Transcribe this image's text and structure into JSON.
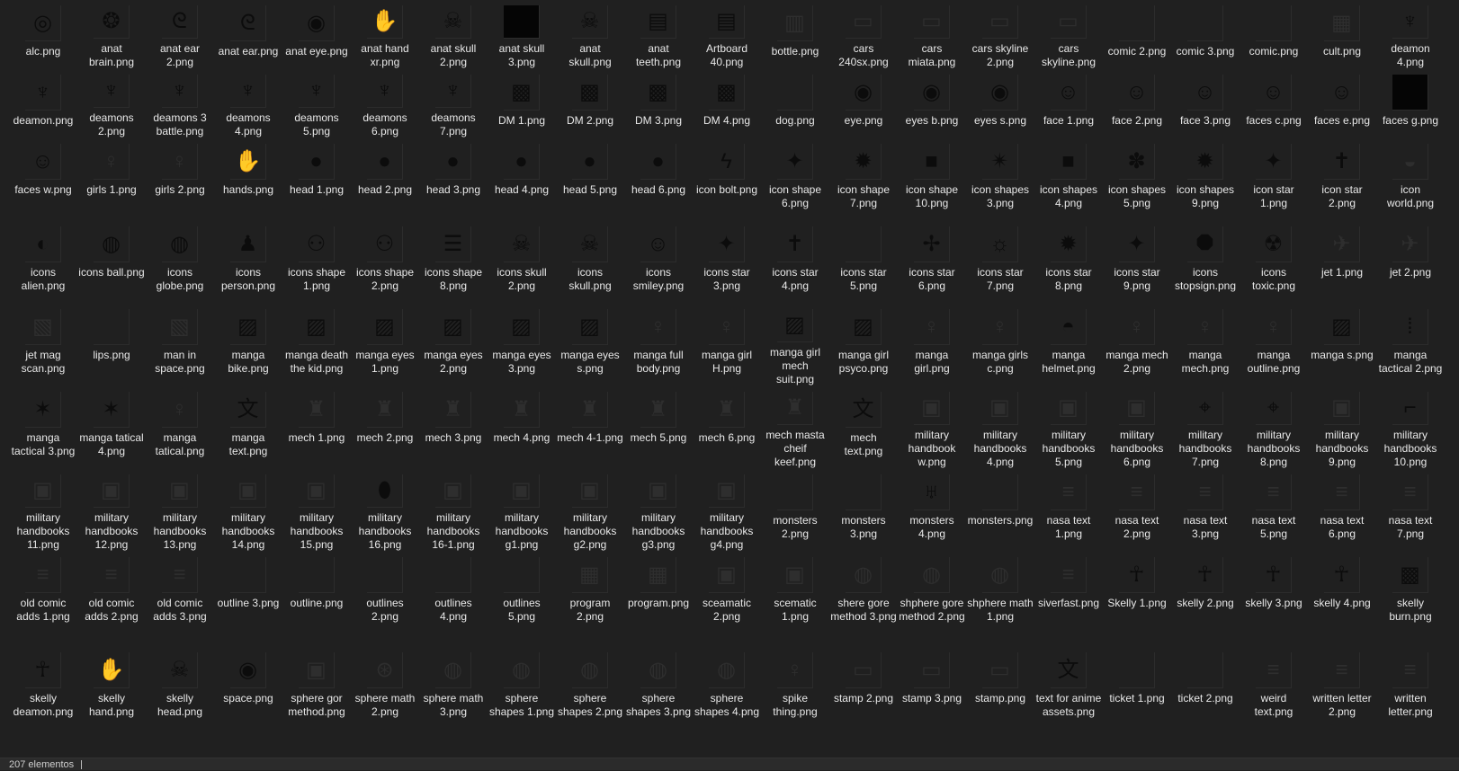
{
  "status": {
    "item_count": "207 elementos"
  },
  "files": [
    {
      "name": "alc.png",
      "icon": "vitruvian-icon"
    },
    {
      "name": "anat brain.png",
      "icon": "brain-icon"
    },
    {
      "name": "anat ear 2.png",
      "icon": "ear-icon"
    },
    {
      "name": "anat ear.png",
      "icon": "ear-icon"
    },
    {
      "name": "anat eye.png",
      "icon": "eye-icon"
    },
    {
      "name": "anat hand xr.png",
      "icon": "hand-icon"
    },
    {
      "name": "anat skull 2.png",
      "icon": "skull-icon"
    },
    {
      "name": "anat skull 3.png",
      "icon": "black-square-icon"
    },
    {
      "name": "anat skull.png",
      "icon": "skull-icon"
    },
    {
      "name": "anat teeth.png",
      "icon": "teeth-icon"
    },
    {
      "name": "Artboard 40.png",
      "icon": "teeth-icon"
    },
    {
      "name": "bottle.png",
      "icon": "bottle-icon"
    },
    {
      "name": "cars 240sx.png",
      "icon": "car-icon"
    },
    {
      "name": "cars miata.png",
      "icon": "car-icon"
    },
    {
      "name": "cars skyline 2.png",
      "icon": "car-icon"
    },
    {
      "name": "cars skyline.png",
      "icon": "car-icon"
    },
    {
      "name": "comic 2.png",
      "icon": "blank-icon"
    },
    {
      "name": "comic 3.png",
      "icon": "blank-icon"
    },
    {
      "name": "comic.png",
      "icon": "blank-icon"
    },
    {
      "name": "cult.png",
      "icon": "poster-icon"
    },
    {
      "name": "deamon 4.png",
      "icon": "demon-icon"
    },
    {
      "name": "deamon.png",
      "icon": "demon-icon"
    },
    {
      "name": "deamons 2.png",
      "icon": "demon-icon"
    },
    {
      "name": "deamons 3 battle.png",
      "icon": "demon-icon"
    },
    {
      "name": "deamons 4.png",
      "icon": "demon-icon"
    },
    {
      "name": "deamons 5.png",
      "icon": "demon-icon"
    },
    {
      "name": "deamons 6.png",
      "icon": "demon-icon"
    },
    {
      "name": "deamons 7.png",
      "icon": "demon-icon"
    },
    {
      "name": "DM 1.png",
      "icon": "dark-scene-icon"
    },
    {
      "name": "DM 2.png",
      "icon": "dark-scene-icon"
    },
    {
      "name": "DM 3.png",
      "icon": "dark-scene-icon"
    },
    {
      "name": "DM 4.png",
      "icon": "dark-scene-icon"
    },
    {
      "name": "dog.png",
      "icon": "blank-icon"
    },
    {
      "name": "eye.png",
      "icon": "eye-icon"
    },
    {
      "name": "eyes b.png",
      "icon": "eye-icon"
    },
    {
      "name": "eyes s.png",
      "icon": "eye-icon"
    },
    {
      "name": "face 1.png",
      "icon": "face-icon"
    },
    {
      "name": "face 2.png",
      "icon": "face-icon"
    },
    {
      "name": "face 3.png",
      "icon": "face-icon"
    },
    {
      "name": "faces c.png",
      "icon": "face-icon"
    },
    {
      "name": "faces e.png",
      "icon": "face-icon"
    },
    {
      "name": "faces g.png",
      "icon": "black-square-icon"
    },
    {
      "name": "faces w.png",
      "icon": "face-icon"
    },
    {
      "name": "girls 1.png",
      "icon": "figure-icon"
    },
    {
      "name": "girls 2.png",
      "icon": "figure-icon"
    },
    {
      "name": "hands.png",
      "icon": "hand-icon"
    },
    {
      "name": "head 1.png",
      "icon": "head-icon"
    },
    {
      "name": "head 2.png",
      "icon": "head-icon"
    },
    {
      "name": "head 3.png",
      "icon": "head-icon"
    },
    {
      "name": "head 4.png",
      "icon": "head-icon"
    },
    {
      "name": "head 5.png",
      "icon": "head-icon"
    },
    {
      "name": "head 6.png",
      "icon": "head-icon"
    },
    {
      "name": "icon bolt.png",
      "icon": "bolt-icon"
    },
    {
      "name": "icon shape 6.png",
      "icon": "sparkle-icon"
    },
    {
      "name": "icon shape 7.png",
      "icon": "starburst-icon"
    },
    {
      "name": "icon shape 10.png",
      "icon": "square-shape-icon"
    },
    {
      "name": "icon shapes 3.png",
      "icon": "octagram-icon"
    },
    {
      "name": "icon shapes 4.png",
      "icon": "square-shape-icon"
    },
    {
      "name": "icon shapes 5.png",
      "icon": "flower-icon"
    },
    {
      "name": "icon shapes 9.png",
      "icon": "starburst-icon"
    },
    {
      "name": "icon star 1.png",
      "icon": "star-icon"
    },
    {
      "name": "icon star 2.png",
      "icon": "cross-star-icon"
    },
    {
      "name": "icon world.png",
      "icon": "world-map-icon"
    },
    {
      "name": "icons alien.png",
      "icon": "alien-icon"
    },
    {
      "name": "icons ball.png",
      "icon": "globe-icon"
    },
    {
      "name": "icons globe.png",
      "icon": "globe-icon"
    },
    {
      "name": "icons person.png",
      "icon": "person-icon"
    },
    {
      "name": "icons shape 1.png",
      "icon": "node-shape-icon"
    },
    {
      "name": "icons shape 2.png",
      "icon": "node-shape-icon"
    },
    {
      "name": "icons shape 8.png",
      "icon": "stripes-icon"
    },
    {
      "name": "icons skull 2.png",
      "icon": "skull-crossbones-icon"
    },
    {
      "name": "icons skull.png",
      "icon": "skull-crossbones-icon"
    },
    {
      "name": "icons smiley.png",
      "icon": "smiley-icon"
    },
    {
      "name": "icons star 3.png",
      "icon": "star-icon"
    },
    {
      "name": "icons star 4.png",
      "icon": "cross-star-icon"
    },
    {
      "name": "icons star 5.png",
      "icon": "blank-icon"
    },
    {
      "name": "icons star 6.png",
      "icon": "pinwheel-icon"
    },
    {
      "name": "icons star 7.png",
      "icon": "sun-icon"
    },
    {
      "name": "icons star 8.png",
      "icon": "starburst-icon"
    },
    {
      "name": "icons star 9.png",
      "icon": "star-icon"
    },
    {
      "name": "icons stopsign.png",
      "icon": "stop-sign-icon"
    },
    {
      "name": "icons toxic.png",
      "icon": "radiation-icon"
    },
    {
      "name": "jet 1.png",
      "icon": "jet-icon"
    },
    {
      "name": "jet 2.png",
      "icon": "jet-icon"
    },
    {
      "name": "jet mag scan.png",
      "icon": "magazine-icon"
    },
    {
      "name": "lips.png",
      "icon": "blank-icon"
    },
    {
      "name": "man in space.png",
      "icon": "magazine-icon"
    },
    {
      "name": "manga bike.png",
      "icon": "manga-icon"
    },
    {
      "name": "manga death the kid.png",
      "icon": "manga-icon"
    },
    {
      "name": "manga eyes 1.png",
      "icon": "manga-icon"
    },
    {
      "name": "manga eyes 2.png",
      "icon": "manga-icon"
    },
    {
      "name": "manga eyes 3.png",
      "icon": "manga-icon"
    },
    {
      "name": "manga eyes s.png",
      "icon": "manga-icon"
    },
    {
      "name": "manga full body.png",
      "icon": "figure-icon"
    },
    {
      "name": "manga girl H.png",
      "icon": "figure-icon"
    },
    {
      "name": "manga girl mech suit.png",
      "icon": "manga-icon"
    },
    {
      "name": "manga girl psyco.png",
      "icon": "manga-icon"
    },
    {
      "name": "manga girl.png",
      "icon": "figure-icon"
    },
    {
      "name": "manga girls c.png",
      "icon": "figure-icon"
    },
    {
      "name": "manga helmet.png",
      "icon": "helmet-icon"
    },
    {
      "name": "manga mech 2.png",
      "icon": "figure-icon"
    },
    {
      "name": "manga mech.png",
      "icon": "figure-icon"
    },
    {
      "name": "manga outline.png",
      "icon": "figure-icon"
    },
    {
      "name": "manga s.png",
      "icon": "manga-icon"
    },
    {
      "name": "manga tactical 2.png",
      "icon": "ammo-icon"
    },
    {
      "name": "manga tactical 3.png",
      "icon": "shuriken-icon"
    },
    {
      "name": "manga tatical 4.png",
      "icon": "shuriken-icon"
    },
    {
      "name": "manga tatical.png",
      "icon": "figure-icon"
    },
    {
      "name": "manga text.png",
      "icon": "kanji-icon"
    },
    {
      "name": "mech 1.png",
      "icon": "mech-icon"
    },
    {
      "name": "mech 2.png",
      "icon": "mech-icon"
    },
    {
      "name": "mech 3.png",
      "icon": "mech-icon"
    },
    {
      "name": "mech 4.png",
      "icon": "mech-icon"
    },
    {
      "name": "mech 4-1.png",
      "icon": "mech-icon"
    },
    {
      "name": "mech 5.png",
      "icon": "mech-icon"
    },
    {
      "name": "mech 6.png",
      "icon": "mech-icon"
    },
    {
      "name": "mech masta cheif keef.png",
      "icon": "mech-icon"
    },
    {
      "name": "mech text.png",
      "icon": "kanji-icon"
    },
    {
      "name": "military handbook w.png",
      "icon": "diagram-icon"
    },
    {
      "name": "military handbooks 4.png",
      "icon": "diagram-icon"
    },
    {
      "name": "military handbooks 5.png",
      "icon": "diagram-icon"
    },
    {
      "name": "military handbooks 6.png",
      "icon": "diagram-icon"
    },
    {
      "name": "military handbooks 7.png",
      "icon": "crosshair-icon"
    },
    {
      "name": "military handbooks 8.png",
      "icon": "crosshair-icon"
    },
    {
      "name": "military handbooks 9.png",
      "icon": "diagram-icon"
    },
    {
      "name": "military handbooks 10.png",
      "icon": "pistol-icon"
    },
    {
      "name": "military handbooks 11.png",
      "icon": "diagram-icon"
    },
    {
      "name": "military handbooks 12.png",
      "icon": "diagram-icon"
    },
    {
      "name": "military handbooks 13.png",
      "icon": "diagram-icon"
    },
    {
      "name": "military handbooks 14.png",
      "icon": "diagram-icon"
    },
    {
      "name": "military handbooks 15.png",
      "icon": "diagram-icon"
    },
    {
      "name": "military handbooks 16.png",
      "icon": "grenade-icon"
    },
    {
      "name": "military handbooks 16-1.png",
      "icon": "diagram-icon"
    },
    {
      "name": "military handbooks g1.png",
      "icon": "diagram-icon"
    },
    {
      "name": "military handbooks g2.png",
      "icon": "diagram-icon"
    },
    {
      "name": "military handbooks g3.png",
      "icon": "diagram-icon"
    },
    {
      "name": "military handbooks g4.png",
      "icon": "diagram-icon"
    },
    {
      "name": "monsters 2.png",
      "icon": "blank-icon"
    },
    {
      "name": "monsters 3.png",
      "icon": "blank-icon"
    },
    {
      "name": "monsters 4.png",
      "icon": "monster-icon"
    },
    {
      "name": "monsters.png",
      "icon": "blank-icon"
    },
    {
      "name": "nasa text 1.png",
      "icon": "text-icon"
    },
    {
      "name": "nasa text 2.png",
      "icon": "text-icon"
    },
    {
      "name": "nasa text 3.png",
      "icon": "text-icon"
    },
    {
      "name": "nasa text 5.png",
      "icon": "text-icon"
    },
    {
      "name": "nasa text 6.png",
      "icon": "text-icon"
    },
    {
      "name": "nasa text 7.png",
      "icon": "text-icon"
    },
    {
      "name": "old comic adds 1.png",
      "icon": "text-icon"
    },
    {
      "name": "old comic adds 2.png",
      "icon": "text-icon"
    },
    {
      "name": "old comic adds 3.png",
      "icon": "text-icon"
    },
    {
      "name": "outline 3.png",
      "icon": "blank-icon"
    },
    {
      "name": "outline.png",
      "icon": "blank-icon"
    },
    {
      "name": "outlines 2.png",
      "icon": "blank-icon"
    },
    {
      "name": "outlines 4.png",
      "icon": "blank-icon"
    },
    {
      "name": "outlines 5.png",
      "icon": "blank-icon"
    },
    {
      "name": "program 2.png",
      "icon": "poster-icon"
    },
    {
      "name": "program.png",
      "icon": "poster-icon"
    },
    {
      "name": "sceamatic 2.png",
      "icon": "diagram-icon"
    },
    {
      "name": "scematic 1.png",
      "icon": "diagram-icon"
    },
    {
      "name": "shere gore method 3.png",
      "icon": "sphere-icon"
    },
    {
      "name": "shphere gore method 2.png",
      "icon": "sphere-icon"
    },
    {
      "name": "shphere math 1.png",
      "icon": "sphere-icon"
    },
    {
      "name": "siverfast.png",
      "icon": "text-icon"
    },
    {
      "name": "Skelly 1.png",
      "icon": "skeleton-icon"
    },
    {
      "name": "skelly 2.png",
      "icon": "skeleton-icon"
    },
    {
      "name": "skelly 3.png",
      "icon": "skeleton-icon"
    },
    {
      "name": "skelly 4.png",
      "icon": "skeleton-icon"
    },
    {
      "name": "skelly burn.png",
      "icon": "dark-scene-icon"
    },
    {
      "name": "skelly deamon.png",
      "icon": "skeleton-icon"
    },
    {
      "name": "skelly hand.png",
      "icon": "hand-icon"
    },
    {
      "name": "skelly head.png",
      "icon": "skull-icon"
    },
    {
      "name": "space.png",
      "icon": "eye-icon"
    },
    {
      "name": "sphere gor method.png",
      "icon": "diagram-icon"
    },
    {
      "name": "sphere math 2.png",
      "icon": "web-icon"
    },
    {
      "name": "sphere math 3.png",
      "icon": "sphere-icon"
    },
    {
      "name": "sphere shapes 1.png",
      "icon": "sphere-icon"
    },
    {
      "name": "sphere shapes 2.png",
      "icon": "sphere-icon"
    },
    {
      "name": "sphere shapes 3.png",
      "icon": "sphere-icon"
    },
    {
      "name": "sphere shapes 4.png",
      "icon": "sphere-icon"
    },
    {
      "name": "spike thing.png",
      "icon": "figure-icon"
    },
    {
      "name": "stamp 2.png",
      "icon": "stamp-icon"
    },
    {
      "name": "stamp 3.png",
      "icon": "stamp-icon"
    },
    {
      "name": "stamp.png",
      "icon": "stamp-icon"
    },
    {
      "name": "text for anime assets.png",
      "icon": "kanji-icon"
    },
    {
      "name": "ticket 1.png",
      "icon": "blank-icon"
    },
    {
      "name": "ticket 2.png",
      "icon": "blank-icon"
    },
    {
      "name": "weird text.png",
      "icon": "text-icon"
    },
    {
      "name": "written letter 2.png",
      "icon": "text-icon"
    },
    {
      "name": "written letter.png",
      "icon": "text-icon"
    }
  ]
}
